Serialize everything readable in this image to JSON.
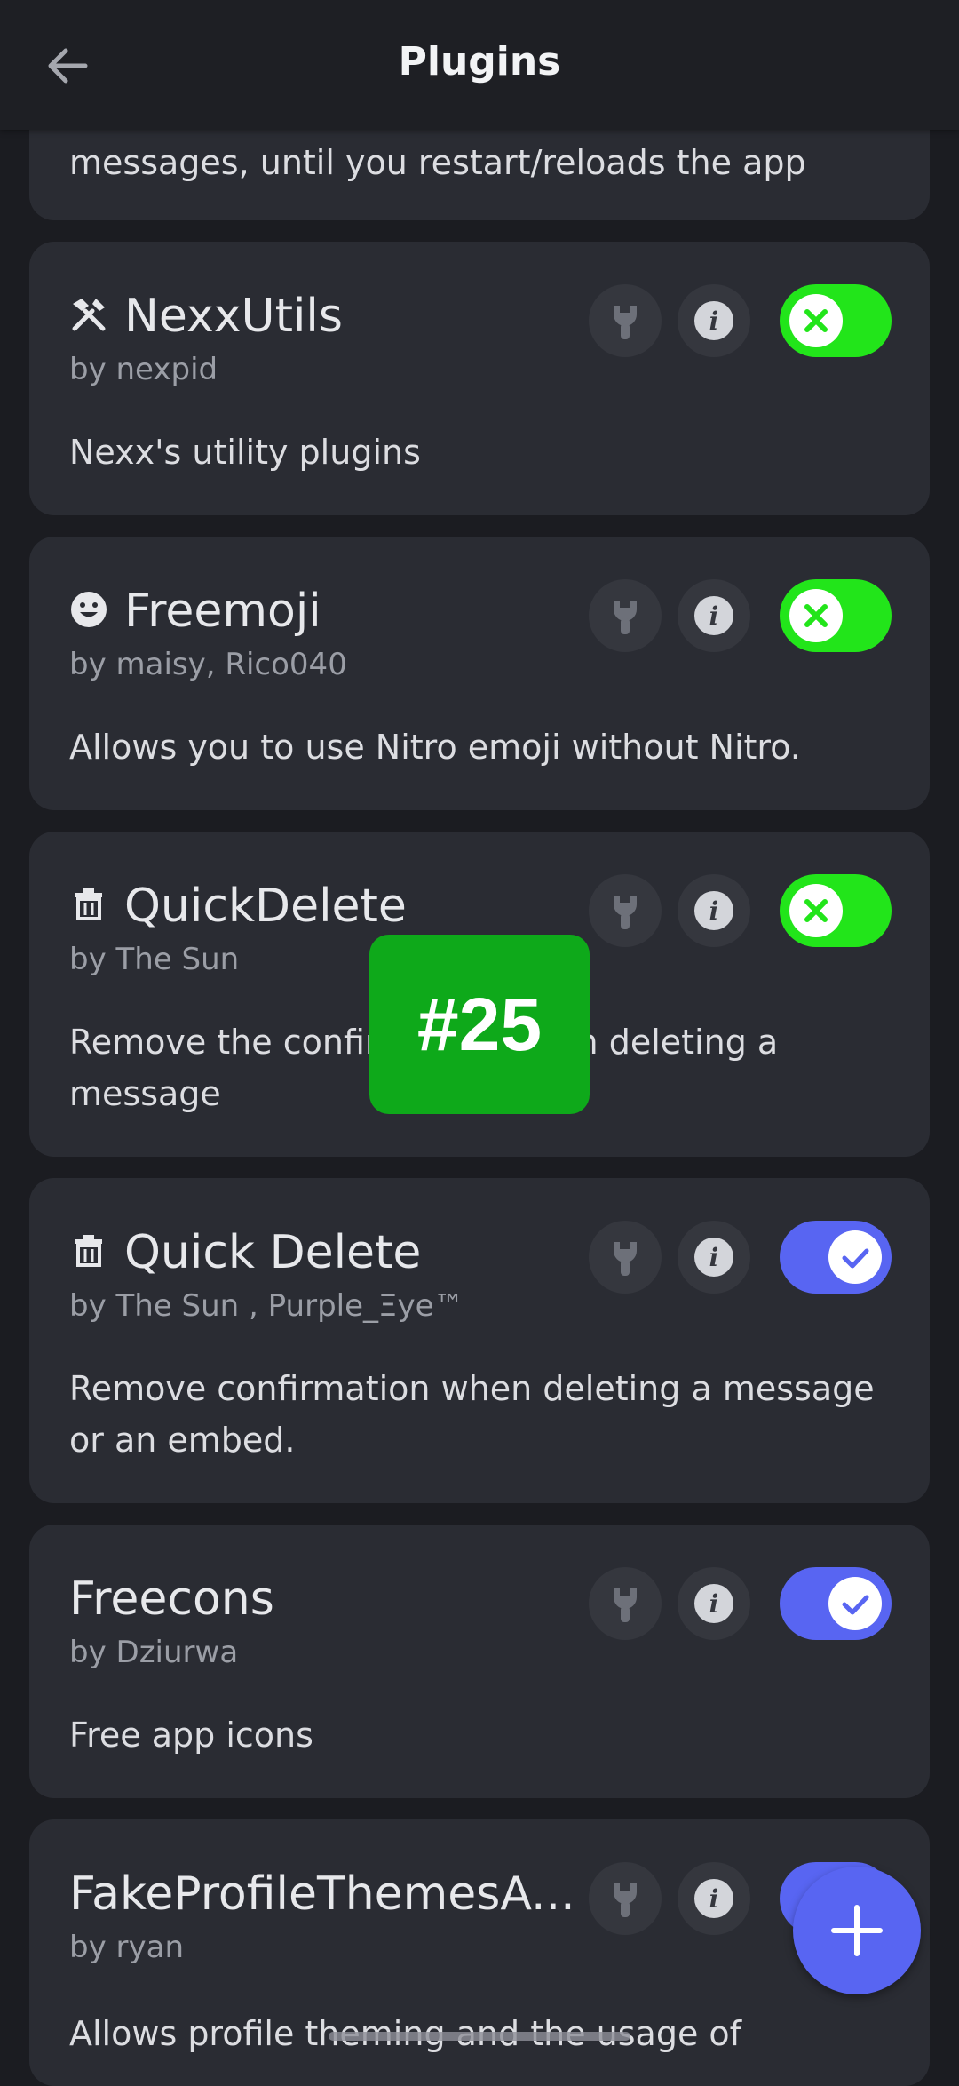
{
  "header": {
    "title": "Plugins"
  },
  "top_card": {
    "desc": "messages, until you restart/reloads the app"
  },
  "plugins": [
    {
      "name": "NexxUtils",
      "author": "by nexpid",
      "desc": "Nexx's utility plugins",
      "enabled": false
    },
    {
      "name": "Freemoji",
      "author": "by maisy, Rico040",
      "desc": "Allows you to use Nitro emoji without Nitro.",
      "enabled": false
    },
    {
      "name": "QuickDelete",
      "author": "by The Sun",
      "desc": "Remove the confirmation when deleting a message",
      "enabled": false
    },
    {
      "name": "Quick Delete",
      "author": "by The Sun , Purple_Ξye™",
      "desc": "Remove confirmation when deleting a message or an embed.",
      "enabled": true
    },
    {
      "name": "Freecons",
      "author": "by Dziurwa",
      "desc": "Free app icons",
      "enabled": true
    },
    {
      "name": "FakeProfileThemesA...",
      "author": "by ryan",
      "desc": "Allows profile theming and the usage of",
      "enabled": true
    }
  ],
  "overlay": {
    "label": "#25"
  },
  "colors": {
    "toggle_off": "#22e51a",
    "toggle_on": "#5865f2",
    "fab": "#5865f2",
    "badge": "#0ea91a"
  }
}
